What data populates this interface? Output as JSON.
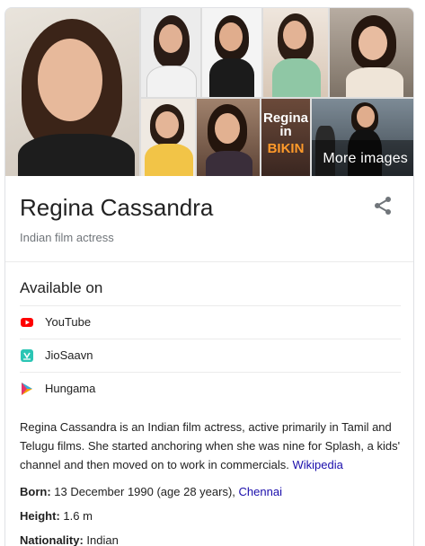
{
  "gallery": {
    "more_label": "More images",
    "thumb_text": "Regina in BIKINI"
  },
  "entity": {
    "name": "Regina Cassandra",
    "subtitle": "Indian film actress"
  },
  "available_on": {
    "title": "Available on",
    "items": [
      {
        "label": "YouTube",
        "icon": "youtube-icon",
        "color": "#ff0000"
      },
      {
        "label": "JioSaavn",
        "icon": "jiosaavn-icon",
        "color": "#2bc5b4"
      },
      {
        "label": "Hungama",
        "icon": "hungama-icon",
        "color": "#f4a300"
      }
    ]
  },
  "description": {
    "text": "Regina Cassandra is an Indian film actress, active primarily in Tamil and Telugu films. She started anchoring when she was nine for Splash, a kids' channel and then moved on to work in commercials.",
    "source_link": "Wikipedia"
  },
  "facts": {
    "born_label": "Born:",
    "born_value": "13 December 1990 (age 28 years),",
    "born_link": "Chennai",
    "height_label": "Height:",
    "height_value": "1.6 m",
    "nationality_label": "Nationality:",
    "nationality_value": "Indian"
  },
  "colors": {
    "link": "#1a0dab",
    "secondary_text": "#70757a",
    "divider": "#ebebeb"
  }
}
